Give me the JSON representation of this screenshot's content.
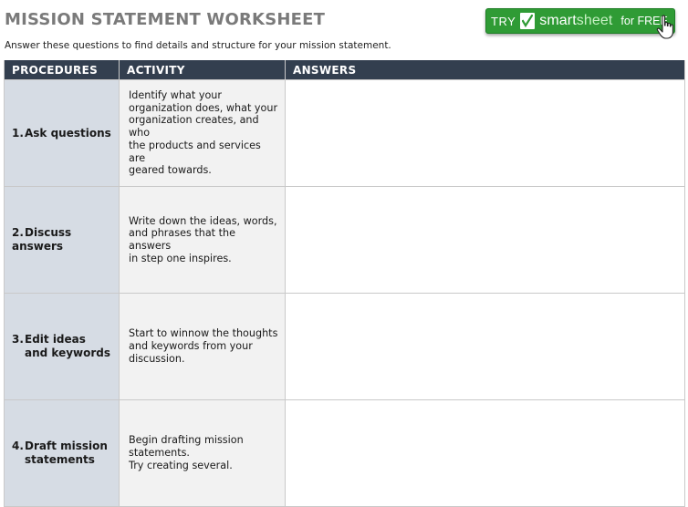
{
  "header": {
    "title": "MISSION STATEMENT WORKSHEET",
    "subtitle": "Answer these questions to find details and structure for your mission statement."
  },
  "cta": {
    "try": "TRY",
    "brand_smart": "smart",
    "brand_sheet": "sheet",
    "free": "for FREE",
    "color": "#2f9b35"
  },
  "table": {
    "columns": [
      "PROCEDURES",
      "ACTIVITY",
      "ANSWERS"
    ],
    "header_color": "#333f4f",
    "rows": [
      {
        "num": "1.",
        "procedure_line1": "Ask questions",
        "procedure_line2": "",
        "activity": [
          "Identify what your",
          "organization does, what your",
          "organization creates, and who",
          "the products and services are",
          "geared towards."
        ],
        "answer": ""
      },
      {
        "num": "2.",
        "procedure_line1": "Discuss answers",
        "procedure_line2": "",
        "activity": [
          "Write down the ideas, words,",
          "and phrases that the answers",
          "in step one inspires."
        ],
        "answer": ""
      },
      {
        "num": "3.",
        "procedure_line1": "Edit ideas",
        "procedure_line2": "and keywords",
        "activity": [
          "Start to winnow the thoughts",
          "and keywords from your",
          "discussion."
        ],
        "answer": ""
      },
      {
        "num": "4.",
        "procedure_line1": "Draft mission",
        "procedure_line2": "statements",
        "activity": [
          "Begin drafting mission",
          "statements.",
          "Try creating several."
        ],
        "answer": ""
      }
    ]
  }
}
